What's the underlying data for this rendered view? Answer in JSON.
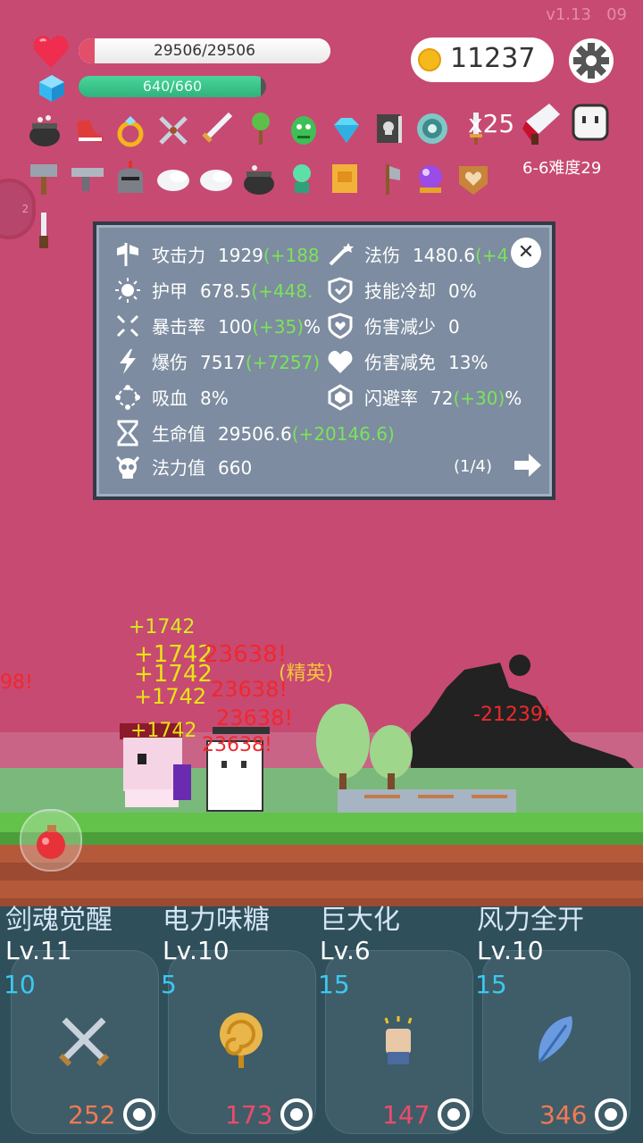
{
  "version": "v1.13",
  "version_tail": "09",
  "player": {
    "hp_text": "29506/29506",
    "hp_fraction": 1.0,
    "mp_text": "640/660",
    "mp_fraction": 0.97
  },
  "coins": "11237",
  "item_stack": "x25",
  "stage": "6-6难度29",
  "side_badge": "2",
  "stats_panel": {
    "rows": [
      {
        "icon": "axe-icon",
        "label": "攻击力",
        "value": "1929",
        "bonus": "(+188"
      },
      {
        "icon": "magic-wand-icon",
        "label": "法伤",
        "value": "1480.6",
        "bonus": "(+4"
      },
      {
        "icon": "sun-icon",
        "label": "护甲",
        "value": "678.5",
        "bonus": "(+448."
      },
      {
        "icon": "shield-icon",
        "label": "技能冷却",
        "value": "0%",
        "bonus": ""
      },
      {
        "icon": "crosshair-icon",
        "label": "暴击率",
        "value": "100",
        "bonus": "(+35)",
        "suffix": "%"
      },
      {
        "icon": "heart-shield-icon",
        "label": "伤害减少",
        "value": "0",
        "bonus": ""
      },
      {
        "icon": "lightning-icon",
        "label": "爆伤",
        "value": "7517",
        "bonus": "(+7257)"
      },
      {
        "icon": "heart-icon",
        "label": "伤害减免",
        "value": "13%",
        "bonus": ""
      },
      {
        "icon": "blood-ring-icon",
        "label": "吸血",
        "value": "8%",
        "bonus": ""
      },
      {
        "icon": "gem-shield-icon",
        "label": "闪避率",
        "value": "72",
        "bonus": "(+30)",
        "suffix": "%"
      },
      {
        "icon": "hourglass-icon",
        "label": "生命值",
        "value": "29506.6",
        "bonus": "(+20146.6)"
      },
      {
        "icon": "skull-icon",
        "label": "法力值",
        "value": "660",
        "bonus": ""
      }
    ],
    "page": "(1/4)"
  },
  "battle_text": {
    "heal_1": "+1742",
    "elite": "(精英)",
    "dmg_right": "-21239!",
    "dmg_left": "98!",
    "dmg_mid": "23638!"
  },
  "skills": [
    {
      "name": "剑魂觉醒",
      "level": "Lv.11",
      "cost": "10",
      "count": "252",
      "icon": "crossed-swords-icon",
      "count_color": "#f07a54"
    },
    {
      "name": "电力味糖",
      "level": "Lv.10",
      "cost": "5",
      "count": "173",
      "icon": "lollipop-icon",
      "count_color": "#f04a6a"
    },
    {
      "name": "巨大化",
      "level": "Lv.6",
      "cost": "15",
      "count": "147",
      "icon": "fist-icon",
      "count_color": "#f04a6a"
    },
    {
      "name": "风力全开",
      "level": "Lv.10",
      "cost": "15",
      "count": "346",
      "icon": "feather-icon",
      "count_color": "#f07a54"
    }
  ],
  "colors": {
    "background": "#c74a72",
    "panel": "#7d8ca0",
    "bonus": "#7be35a",
    "accent_blue": "#3bc9f0"
  }
}
